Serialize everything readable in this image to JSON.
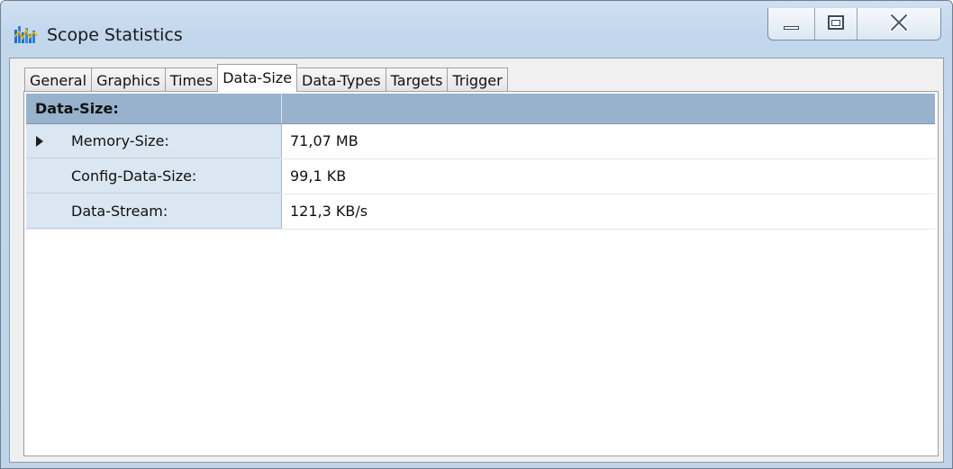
{
  "window": {
    "title": "Scope Statistics",
    "app_icon": "scope-bars-icon",
    "caption_buttons": [
      "minimize-icon",
      "maximize-icon",
      "close-icon"
    ]
  },
  "tabs": [
    {
      "label": "General",
      "active": false
    },
    {
      "label": "Graphics",
      "active": false
    },
    {
      "label": "Times",
      "active": false
    },
    {
      "label": "Data-Size",
      "active": true
    },
    {
      "label": "Data-Types",
      "active": false
    },
    {
      "label": "Targets",
      "active": false
    },
    {
      "label": "Trigger",
      "active": false
    }
  ],
  "grid": {
    "category": "Data-Size:",
    "rows": [
      {
        "name": "Memory-Size:",
        "value": "71,07 MB",
        "expandable": true
      },
      {
        "name": "Config-Data-Size:",
        "value": "99,1 KB",
        "expandable": false
      },
      {
        "name": "Data-Stream:",
        "value": "121,3 KB/s",
        "expandable": false
      }
    ]
  },
  "colors": {
    "header_bg": "#98b1cc",
    "name_cell_bg": "#dae6f2",
    "frame_bg": "#c2d6ec"
  }
}
